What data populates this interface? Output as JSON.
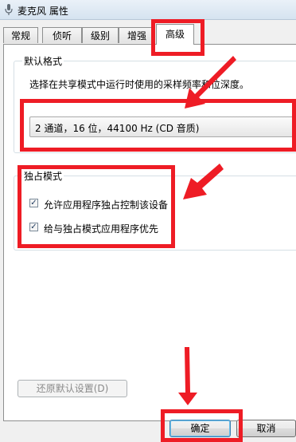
{
  "window": {
    "title": "麦克风 属性"
  },
  "tabs": [
    {
      "label": "常规",
      "active": false
    },
    {
      "label": "侦听",
      "active": false
    },
    {
      "label": "级别",
      "active": false
    },
    {
      "label": "增强",
      "active": false
    },
    {
      "label": "高级",
      "active": true
    }
  ],
  "default_format": {
    "group_label": "默认格式",
    "description": "选择在共享模式中运行时使用的采样频率和位深度。",
    "selected_format": "2 通道，16 位，44100 Hz (CD 音质)"
  },
  "exclusive_mode": {
    "group_label": "独占模式",
    "options": [
      {
        "label": "允许应用程序独占控制该设备",
        "checked": true
      },
      {
        "label": "给与独占模式应用程序优先",
        "checked": true
      }
    ]
  },
  "buttons": {
    "restore_defaults": "还原默认设置(D)",
    "ok": "确定",
    "cancel": "取消"
  },
  "colors": {
    "annotation": "#ee1c25"
  }
}
